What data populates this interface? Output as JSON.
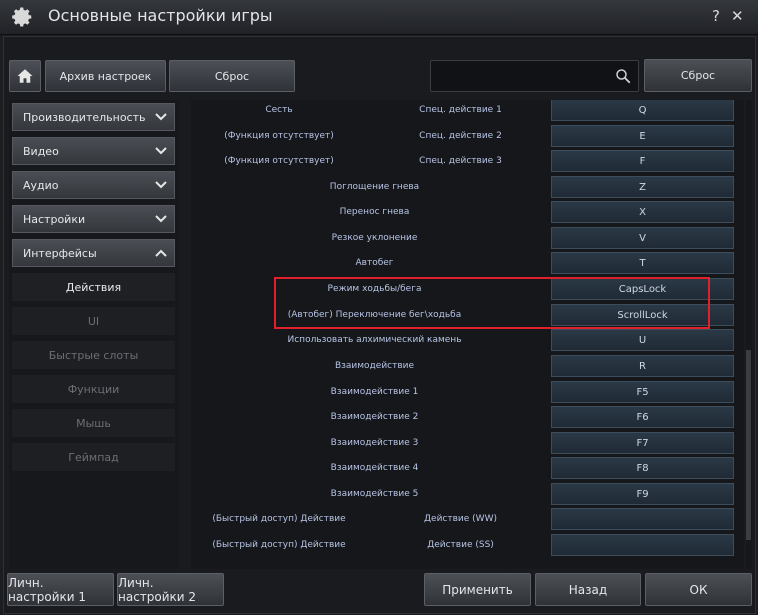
{
  "window": {
    "title": "Основные настройки игры",
    "help": "?",
    "close": "✕"
  },
  "toolbar": {
    "archive": "Архив настроек",
    "reset": "Сброс",
    "search_placeholder": "",
    "reset_right": "Сброс"
  },
  "sidebar": {
    "categories": [
      "Производительность",
      "Видео",
      "Аудио",
      "Настройки",
      "Интерфейсы"
    ],
    "subitems": [
      "Действия",
      "UI",
      "Быстрые слоты",
      "Функции",
      "Мышь",
      "Геймпад"
    ]
  },
  "bindings": [
    {
      "action": "Сесть",
      "secondary": "Спец. действие 1",
      "key": "Q"
    },
    {
      "action": "(Функция отсутствует)",
      "secondary": "Спец. действие 2",
      "key": "E"
    },
    {
      "action": "(Функция отсутствует)",
      "secondary": "Спец. действие 3",
      "key": "F"
    },
    {
      "action": "Поглощение гнева",
      "secondary": "",
      "key": "Z"
    },
    {
      "action": "Перенос гнева",
      "secondary": "",
      "key": "X"
    },
    {
      "action": "Резкое уклонение",
      "secondary": "",
      "key": "V"
    },
    {
      "action": "Автобег",
      "secondary": "",
      "key": "T"
    },
    {
      "action": "Режим ходьбы/бега",
      "secondary": "",
      "key": "CapsLock"
    },
    {
      "action": "(Автобег) Переключение бег\\ходьба",
      "secondary": "",
      "key": "ScrollLock"
    },
    {
      "action": "Использовать алхимический камень",
      "secondary": "",
      "key": "U"
    },
    {
      "action": "Взаимодействие",
      "secondary": "",
      "key": "R"
    },
    {
      "action": "Взаимодействие 1",
      "secondary": "",
      "key": "F5"
    },
    {
      "action": "Взаимодействие 2",
      "secondary": "",
      "key": "F6"
    },
    {
      "action": "Взаимодействие 3",
      "secondary": "",
      "key": "F7"
    },
    {
      "action": "Взаимодействие 4",
      "secondary": "",
      "key": "F8"
    },
    {
      "action": "Взаимодействие 5",
      "secondary": "",
      "key": "F9"
    },
    {
      "action": "(Быстрый доступ) Действие",
      "secondary": "Действие (WW)",
      "key": ""
    },
    {
      "action": "(Быстрый доступ) Действие",
      "secondary": "Действие (SS)",
      "key": ""
    }
  ],
  "footer": {
    "preset1": "Личн. настройки 1",
    "preset2": "Личн. настройки 2",
    "apply": "Применить",
    "back": "Назад",
    "ok": "ОК"
  }
}
